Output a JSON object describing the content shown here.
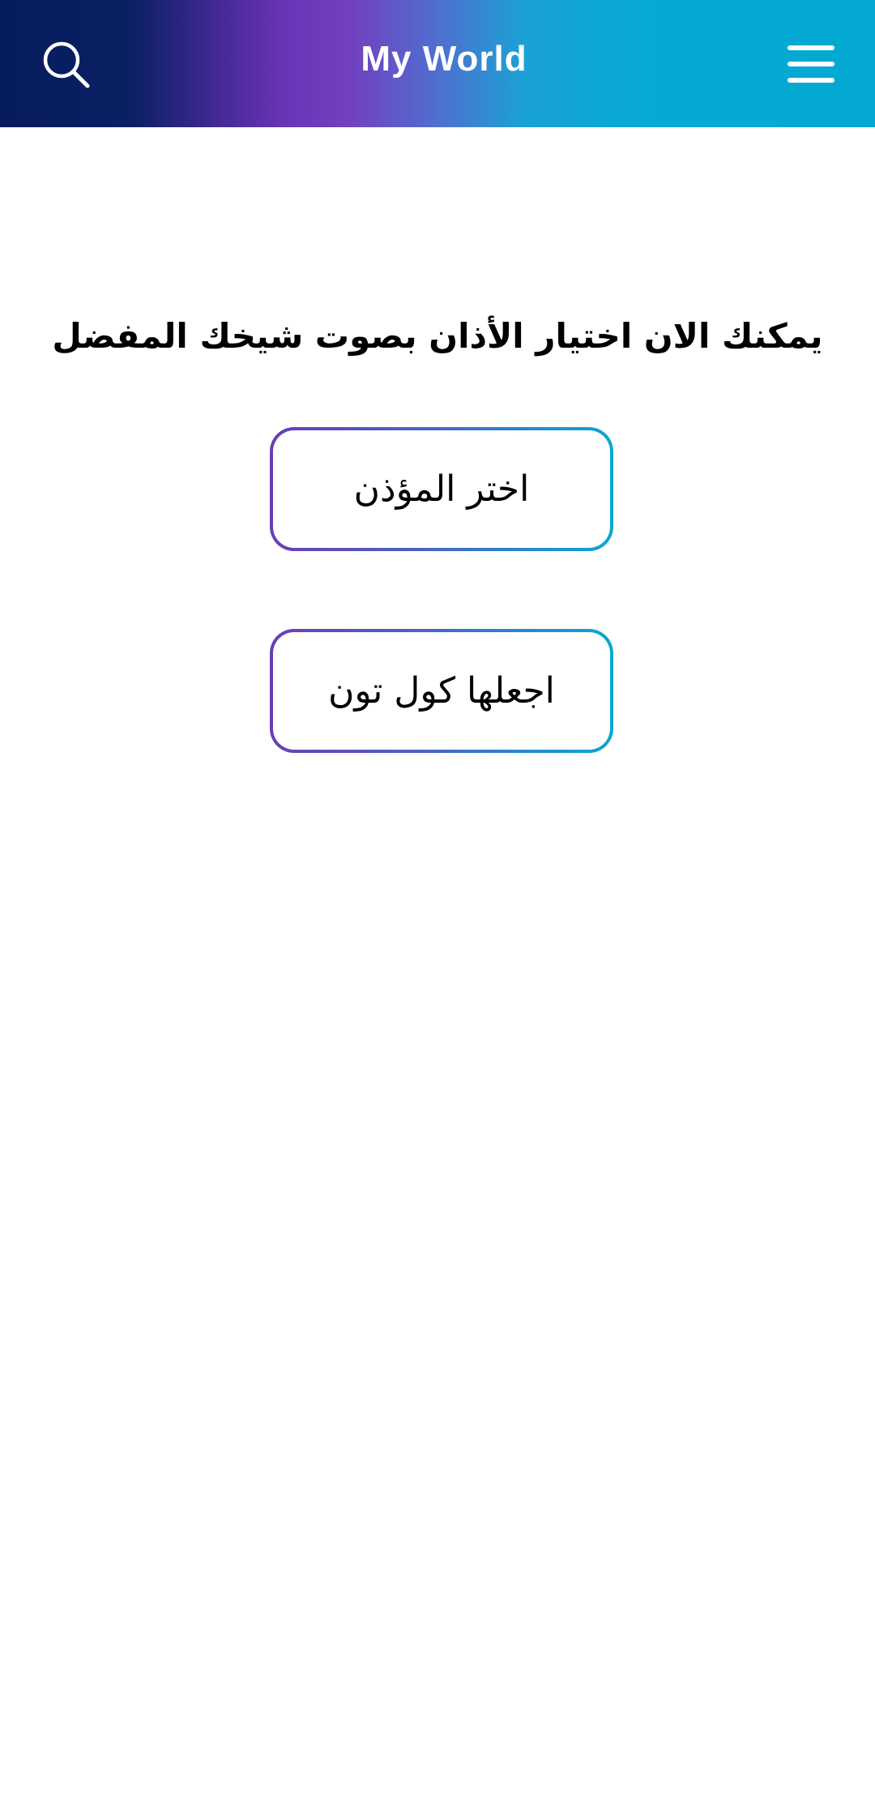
{
  "header": {
    "title": "My World",
    "search_icon": "search-icon",
    "menu_icon": "hamburger-menu-icon",
    "gradient_colors": [
      "#061c5e",
      "#6a35b8",
      "#04a9d2"
    ]
  },
  "main": {
    "headline": "يمكنك الان اختيار الأذان بصوت شيخك المفضل",
    "choose_muezzin_label": "اختر المؤذن",
    "make_calltone_label": "اجعلها كول تون"
  },
  "colors": {
    "background": "#ffffff",
    "text": "#000000",
    "button_border_start": "#6a3db5",
    "button_border_end": "#0ba7d2"
  }
}
